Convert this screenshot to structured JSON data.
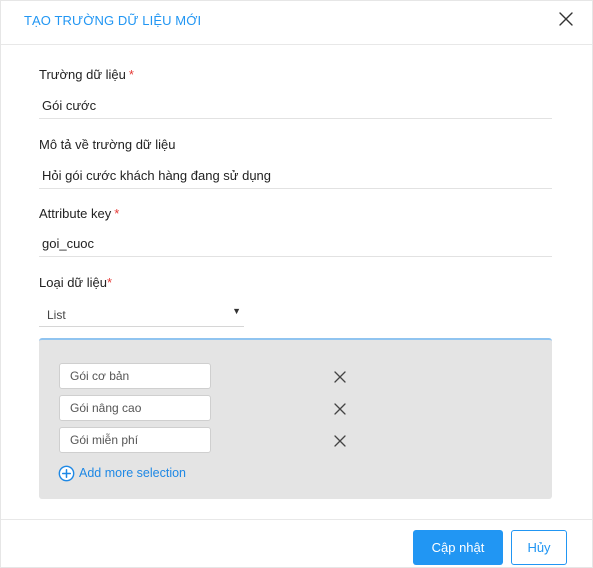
{
  "dialog": {
    "title": "TẠO TRƯỜNG DỮ LIỆU MỚI",
    "close_icon": "close-icon"
  },
  "fields": {
    "field_name": {
      "label": "Trường dữ liệu",
      "required_mark": "*",
      "value": "Gói cước"
    },
    "description": {
      "label": "Mô tả về trường dữ liệu",
      "value": "Hỏi gói cước khách hàng đang sử dụng"
    },
    "attribute_key": {
      "label": "Attribute key",
      "required_mark": "*",
      "value": "goi_cuoc"
    },
    "data_type": {
      "label": "Loại dữ liệu",
      "required_mark": "*",
      "selected": "List",
      "caret": "▼"
    }
  },
  "options": {
    "items": [
      {
        "value": "Gói cơ bản",
        "remove_icon": "close-icon"
      },
      {
        "value": "Gói nâng cao",
        "remove_icon": "close-icon"
      },
      {
        "value": "Gói miễn phí",
        "remove_icon": "close-icon"
      }
    ],
    "add_more_label": "Add more selection",
    "add_icon": "plus-circle-icon"
  },
  "footer": {
    "update_label": "Cập nhật",
    "cancel_label": "Hủy"
  },
  "colors": {
    "accent": "#2196f3",
    "required": "#e53935",
    "panel_bg": "#e4e4e4"
  }
}
